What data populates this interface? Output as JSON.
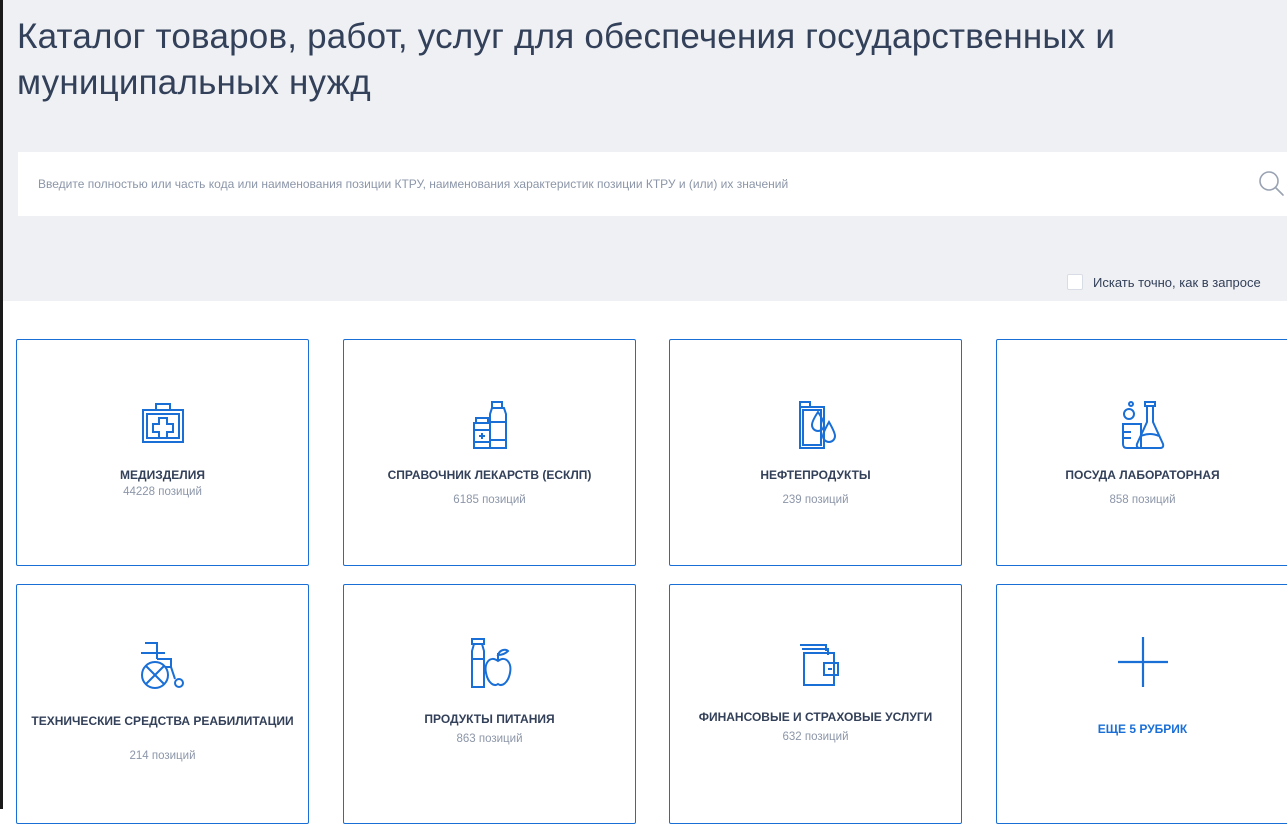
{
  "header": {
    "title": "Каталог товаров, работ, услуг для обеспечения государственных и муниципальных нужд"
  },
  "search": {
    "placeholder": "Введите полностью или часть кода или наименования позиции КТРУ, наименования характеристик позиции КТРУ и (или) их значений",
    "value": "",
    "icon": "search-icon",
    "exact_label": "Искать точно, как в запросе",
    "exact_checked": false
  },
  "colors": {
    "accent": "#1a6fd6",
    "text": "#334059",
    "muted": "#8c96a8",
    "header_bg": "#eef0f3"
  },
  "categories": [
    {
      "title": "МЕДИЗДЕЛИЯ",
      "count": "44228 позиций",
      "icon": "medical-kit-icon"
    },
    {
      "title": "СПРАВОЧНИК ЛЕКАРСТВ (ЕСКЛП)",
      "count": "6185 позиций",
      "icon": "medicine-bottles-icon"
    },
    {
      "title": "НЕФТЕПРОДУКТЫ",
      "count": "239 позиций",
      "icon": "oil-canister-icon"
    },
    {
      "title": "ПОСУДА ЛАБОРАТОРНАЯ",
      "count": "858 позиций",
      "icon": "lab-flask-icon"
    },
    {
      "title": "ТЕХНИЧЕСКИЕ СРЕДСТВА РЕАБИЛИТАЦИИ",
      "count": "214 позиций",
      "icon": "wheelchair-icon"
    },
    {
      "title": "ПРОДУКТЫ ПИТАНИЯ",
      "count": "863 позиций",
      "icon": "food-bottle-apple-icon"
    },
    {
      "title": "ФИНАНСОВЫЕ И СТРАХОВЫЕ УСЛУГИ",
      "count": "632 позиций",
      "icon": "wallet-icon"
    }
  ],
  "more": {
    "label": "ЕЩЕ 5 РУБРИК",
    "icon": "plus-icon"
  }
}
